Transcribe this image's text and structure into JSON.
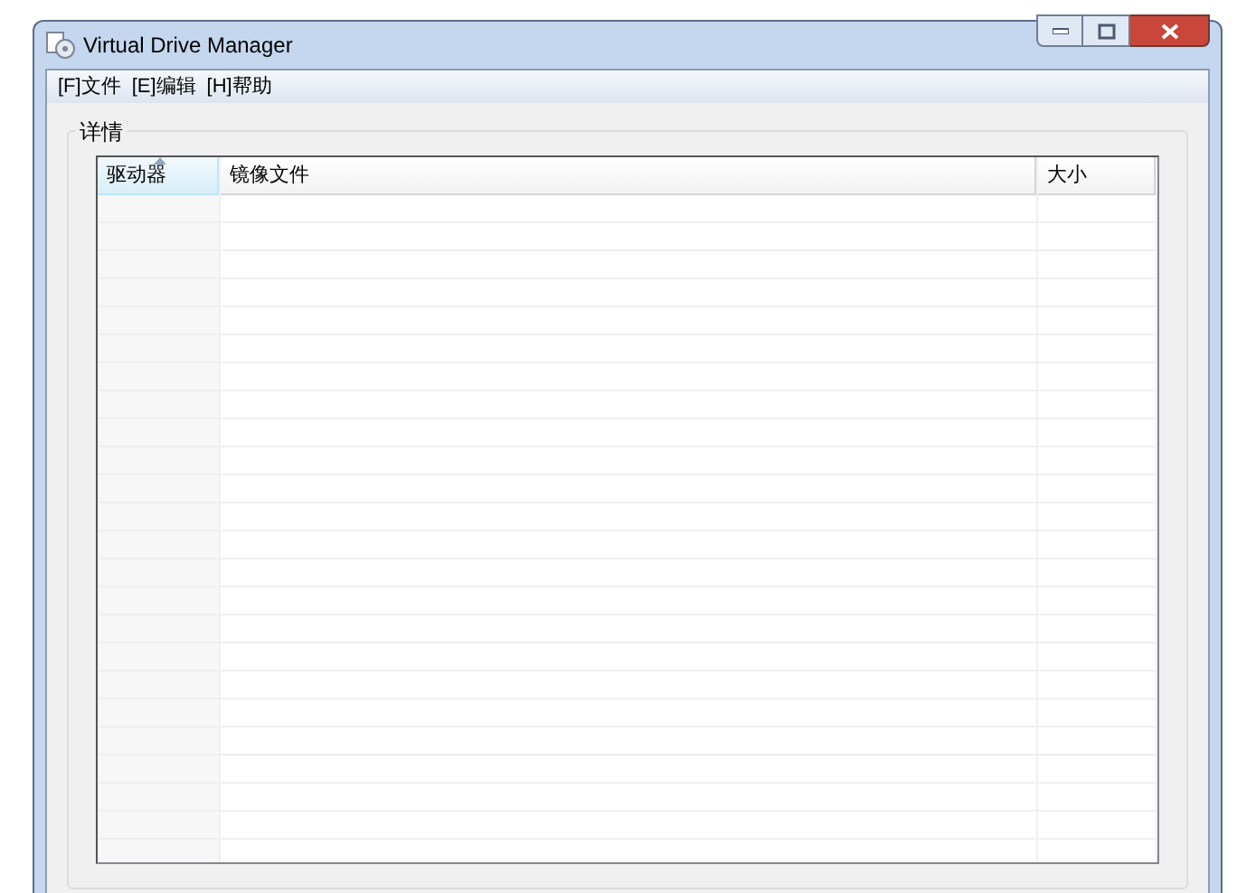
{
  "window": {
    "title": "Virtual Drive Manager"
  },
  "menu": [
    {
      "label": "[F]文件"
    },
    {
      "label": "[E]编辑"
    },
    {
      "label": "[H]帮助"
    }
  ],
  "group": {
    "title": "详情"
  },
  "table": {
    "columns": [
      {
        "label": "驱动器",
        "sorted": true
      },
      {
        "label": "镜像文件",
        "sorted": false
      },
      {
        "label": "大小",
        "sorted": false
      }
    ]
  }
}
